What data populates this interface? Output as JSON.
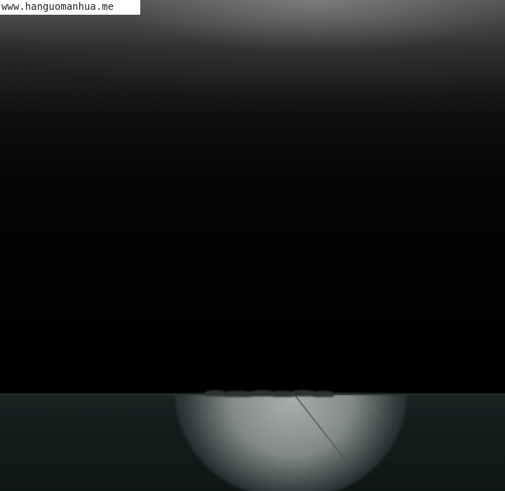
{
  "watermark": {
    "text": "www.hanguomanhua.me"
  },
  "colors": {
    "background": "#000000",
    "floor": "#141c1c",
    "spotlight": "#b0b6b2",
    "watermark_bg": "#ffffff",
    "watermark_text": "#1f1f1f"
  }
}
